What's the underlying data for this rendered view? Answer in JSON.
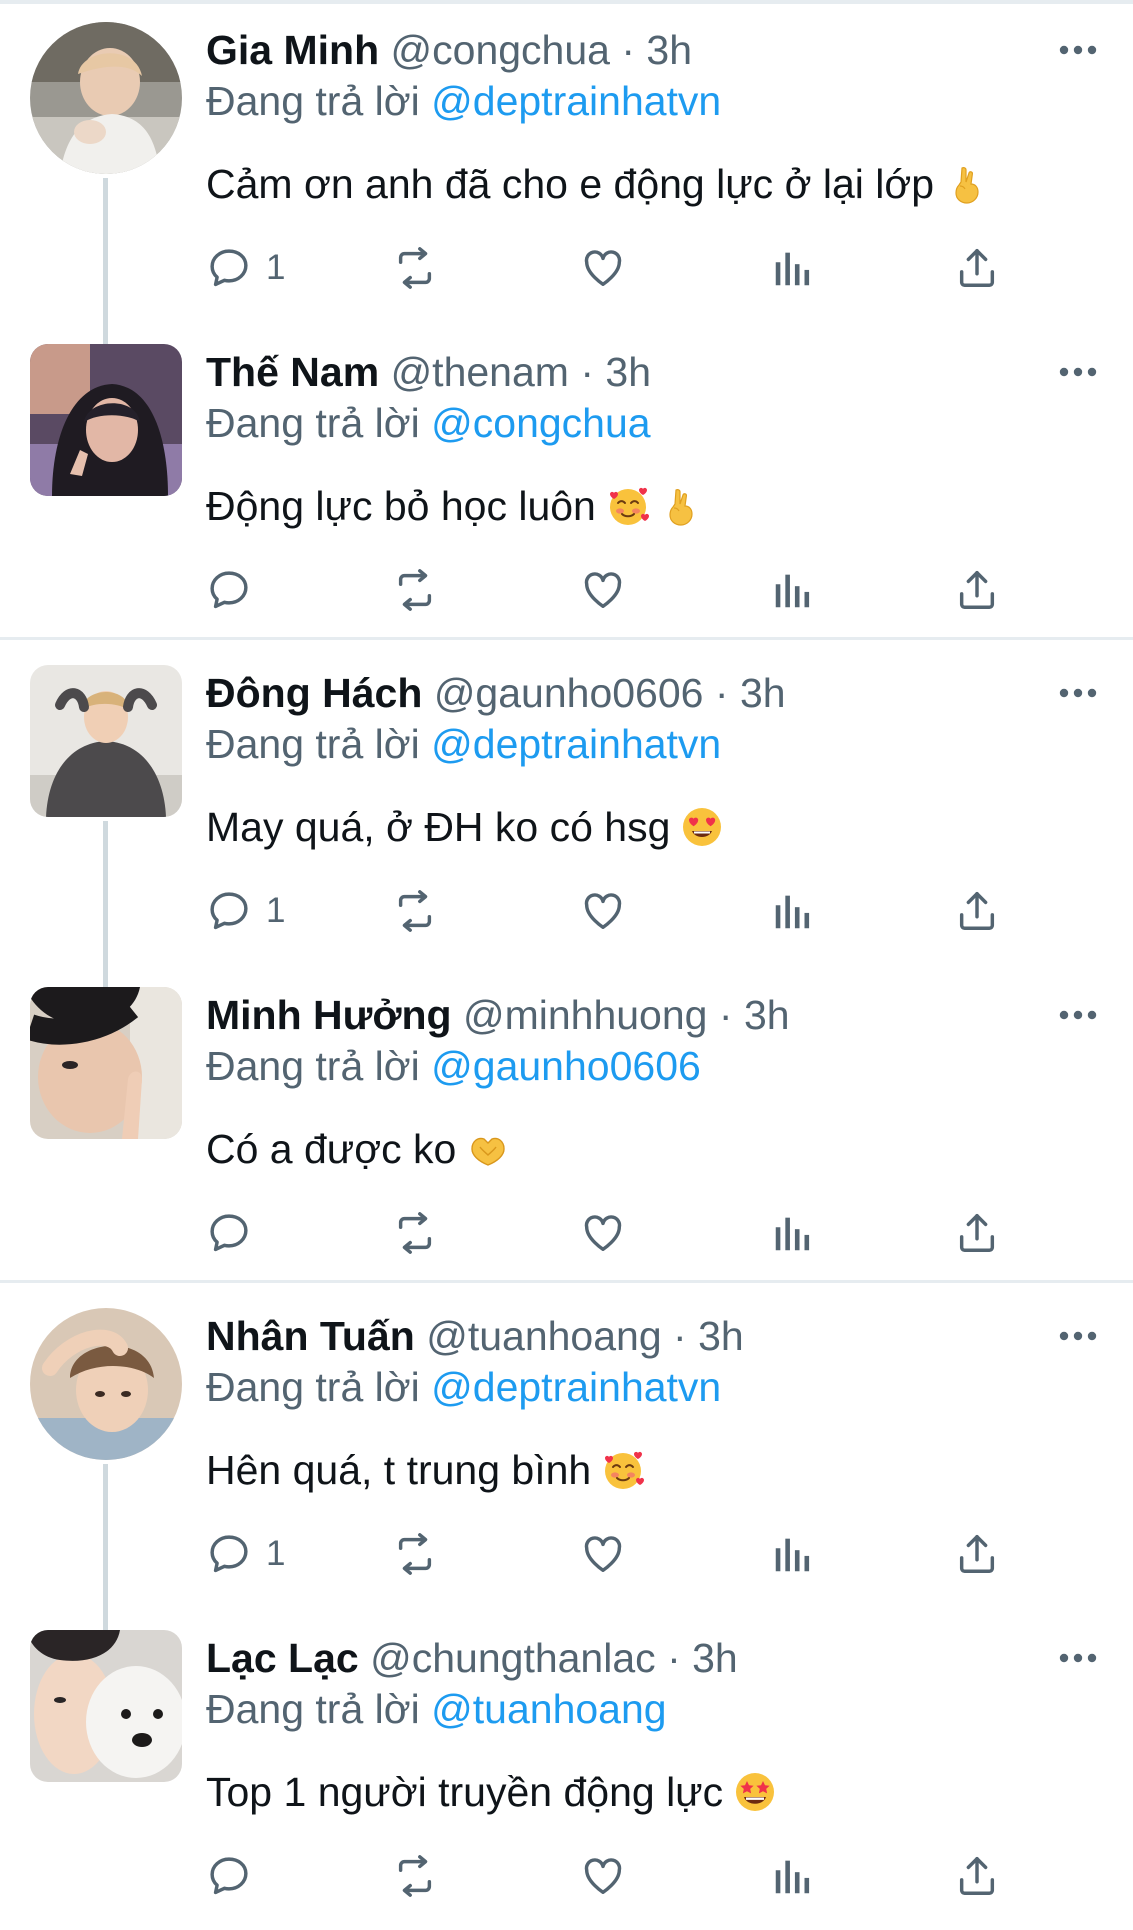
{
  "replying_prefix": "Đang trả lời",
  "separator_dot": "·",
  "colors": {
    "text_primary": "#0f1419",
    "text_secondary": "#536471",
    "link": "#1d9bf0",
    "divider": "#e6ecf0",
    "thread_line": "#cfd9de"
  },
  "action_icons": [
    "reply-icon",
    "retweet-icon",
    "like-icon",
    "views-icon",
    "share-icon"
  ],
  "tweets": [
    {
      "display_name": "Gia Minh",
      "handle": "@congchua",
      "time": "3h",
      "reply_to": "@deptrainhatvn",
      "text": "Cảm ơn anh đã cho e động lực ở lại lớp",
      "emojis": [
        "fingers-crossed-emoji"
      ],
      "reply_count": "1"
    },
    {
      "display_name": "Thế Nam",
      "handle": "@thenam",
      "time": "3h",
      "reply_to": "@congchua",
      "text": "Động lực bỏ học luôn",
      "emojis": [
        "smiling-face-with-hearts-emoji",
        "fingers-crossed-emoji"
      ],
      "reply_count": ""
    },
    {
      "display_name": "Đông Hách",
      "handle": "@gaunho0606",
      "time": "3h",
      "reply_to": "@deptrainhatvn",
      "text": "May quá, ở ĐH ko có hsg",
      "emojis": [
        "heart-eyes-emoji"
      ],
      "reply_count": "1"
    },
    {
      "display_name": "Minh Hưởng",
      "handle": "@minhhuong",
      "time": "3h",
      "reply_to": "@gaunho0606",
      "text": "Có a được ko",
      "emojis": [
        "heart-hands-emoji"
      ],
      "reply_count": ""
    },
    {
      "display_name": "Nhân Tuấn",
      "handle": "@tuanhoang",
      "time": "3h",
      "reply_to": "@deptrainhatvn",
      "text": "Hên quá, t trung bình",
      "emojis": [
        "smiling-face-with-hearts-emoji"
      ],
      "reply_count": "1"
    },
    {
      "display_name": "Lạc Lạc",
      "handle": "@chungthanlac",
      "time": "3h",
      "reply_to": "@tuanhoang",
      "text": "Top 1 người truyền động lực",
      "emojis": [
        "star-struck-emoji"
      ],
      "reply_count": ""
    }
  ]
}
